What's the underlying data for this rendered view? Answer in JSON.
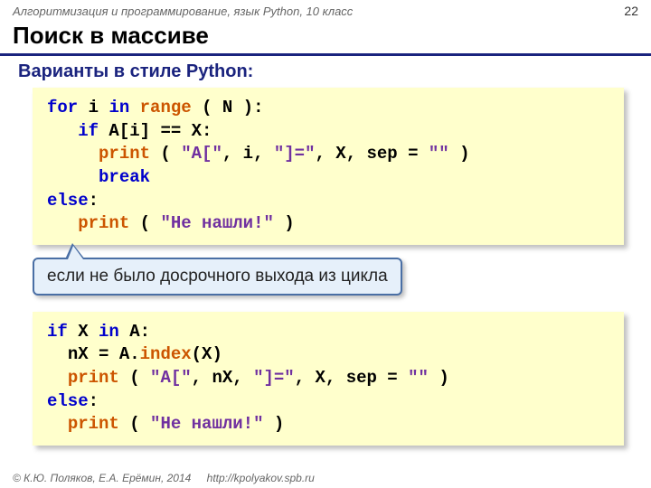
{
  "header": {
    "course": "Алгоритмизация и программирование, язык Python, 10 класс",
    "page": "22"
  },
  "title": "Поиск в массиве",
  "subtitle": "Варианты в стиле Python:",
  "code1": {
    "l1": {
      "kw_for": "for",
      "i": " i ",
      "kw_in": "in",
      "sp": " ",
      "range": "range",
      "rest": " ( N ):"
    },
    "l2": {
      "indent": "   ",
      "kw_if": "if",
      "rest": " A[i] == X:"
    },
    "l3": {
      "indent": "     ",
      "print": "print",
      "open": " ( ",
      "s1": "\"A[\"",
      "c1": ", i, ",
      "s2": "\"]=\"",
      "c2": ", X, sep = ",
      "s3": "\"\"",
      "close": " )"
    },
    "l4": {
      "indent": "     ",
      "brk": "break"
    },
    "l5": {
      "els": "else",
      "colon": ":"
    },
    "l6": {
      "indent": "   ",
      "print": "print",
      "open": " ( ",
      "s1": "\"Не нашли!\"",
      "close": " )"
    }
  },
  "callout": "если не было досрочного выхода из цикла",
  "code2": {
    "l1": {
      "kw_if": "if",
      "x": " X ",
      "kw_in": "in",
      "rest": " A:"
    },
    "l2": {
      "indent": "  ",
      "txt1": "nX = A.",
      "index": "index",
      "txt2": "(X)"
    },
    "l3": {
      "indent": "  ",
      "print": "print",
      "open": " ( ",
      "s1": "\"A[\"",
      "c1": ", nX, ",
      "s2": "\"]=\"",
      "c2": ", X, sep = ",
      "s3": "\"\"",
      "close": " )"
    },
    "l4": {
      "els": "else",
      "colon": ":"
    },
    "l5": {
      "indent": "  ",
      "print": "print",
      "open": " ( ",
      "s1": "\"Не нашли!\"",
      "close": " )"
    }
  },
  "footer": {
    "copyright": "© К.Ю. Поляков, Е.А. Ерёмин, 2014",
    "url": "http://kpolyakov.spb.ru"
  }
}
